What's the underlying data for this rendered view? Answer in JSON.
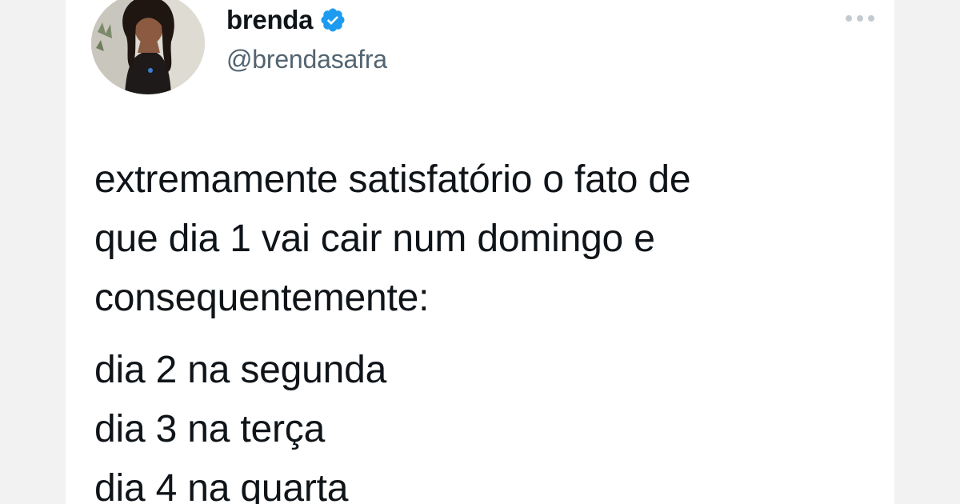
{
  "author": {
    "name": "brenda",
    "handle": "@brendasafra",
    "verified": true,
    "verified_icon": "verified-badge-icon",
    "avatar_icon": "profile-photo"
  },
  "menu": {
    "icon": "more-horizontal-icon"
  },
  "tweet": {
    "paragraphs": [
      {
        "lines": [
          "extremamente satisfatório o fato de",
          "que dia 1 vai cair num domingo e",
          "consequentemente:"
        ]
      },
      {
        "lines": [
          "dia 2 na segunda",
          "dia 3 na terça",
          "dia 4 na quarta"
        ]
      }
    ]
  },
  "colors": {
    "text_primary": "#0f1419",
    "text_secondary": "#536471",
    "verified_blue": "#1d9bf0",
    "side_band": "#f2f2f2"
  }
}
